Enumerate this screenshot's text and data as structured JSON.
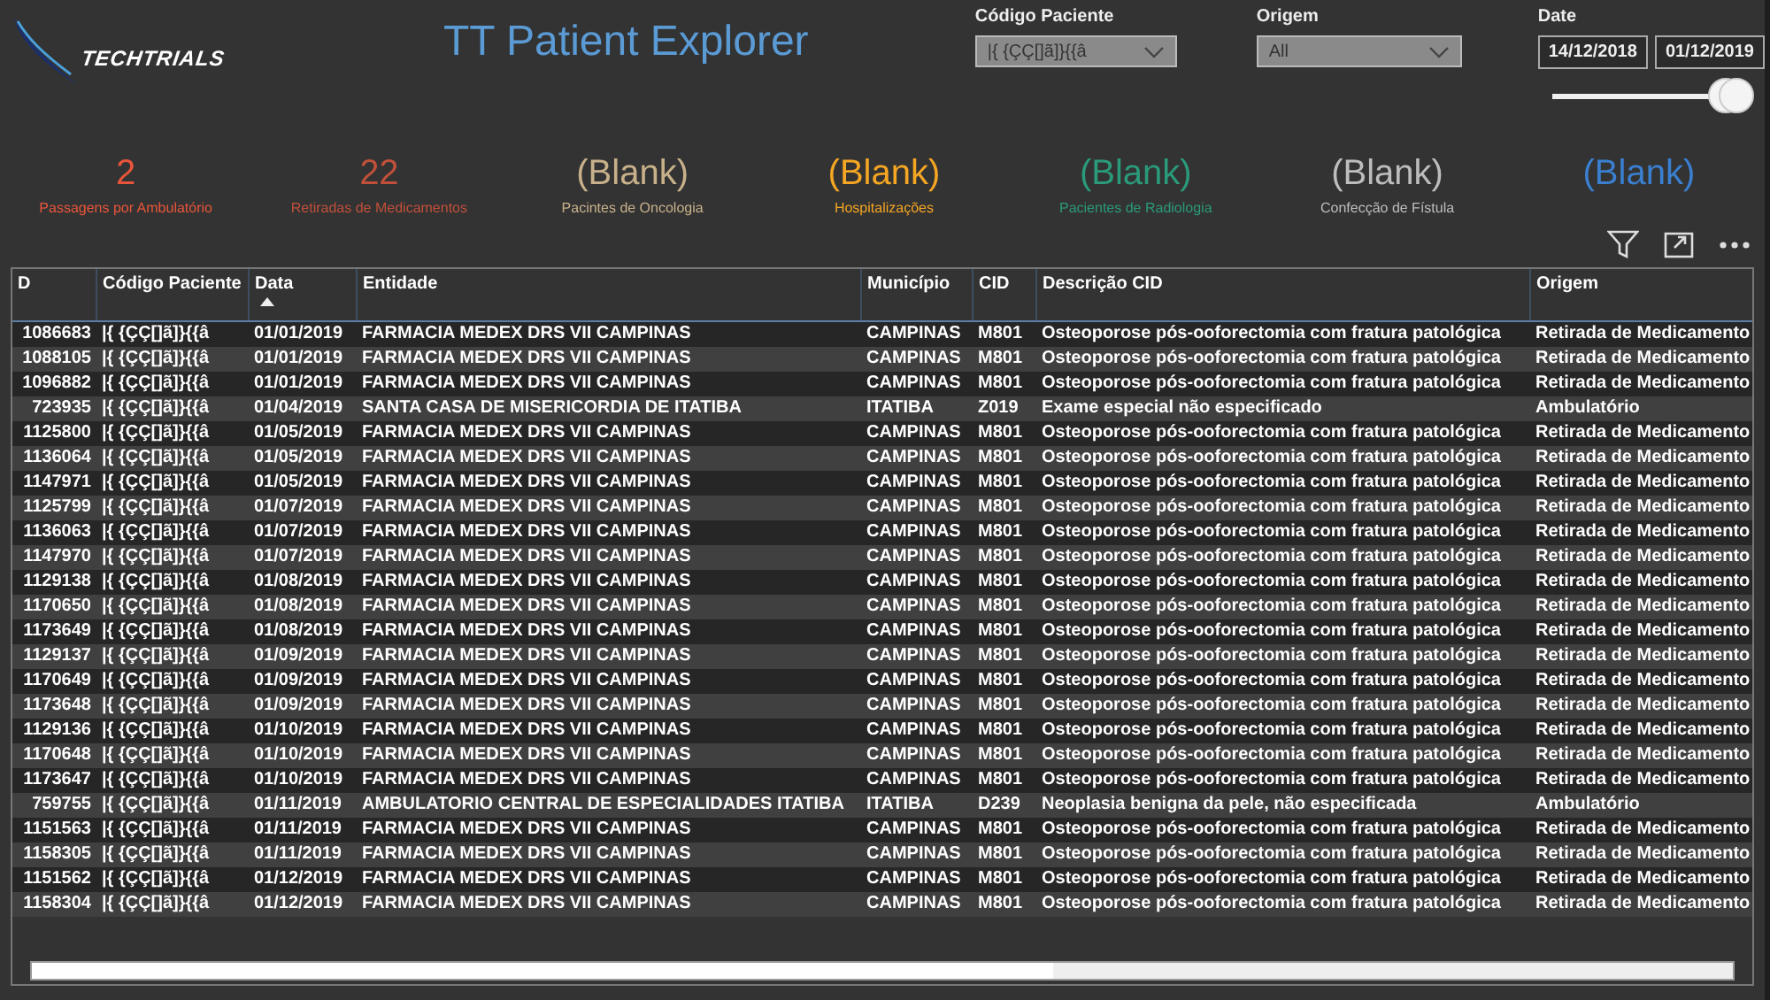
{
  "header": {
    "logo_text": "TECHTRIALS",
    "title": "TT Patient Explorer"
  },
  "filters": [
    {
      "kind": "dropdown",
      "label": "Código Paciente",
      "value": "|{ {ÇÇ[]ã]}{{â"
    },
    {
      "kind": "dropdown",
      "label": "Origem",
      "value": "All"
    },
    {
      "kind": "daterange",
      "label": "Date",
      "from": "14/12/2018",
      "to": "01/12/2019",
      "level": 1
    }
  ],
  "kpis": [
    {
      "value": "2",
      "label": "Passagens por Ambulatório",
      "color": "#e8553a"
    },
    {
      "value": "22",
      "label": "Retiradas de Medicamentos",
      "color": "#c0503a"
    },
    {
      "value": "(Blank)",
      "label": "Pacintes de Oncologia",
      "color": "#c8b18a"
    },
    {
      "value": "(Blank)",
      "label": "Hospitalizações",
      "color": "#f5a623"
    },
    {
      "value": "(Blank)",
      "label": "Pacientes de Radiologia",
      "color": "#2a9a7a"
    },
    {
      "value": "(Blank)",
      "label": "Confecção de Fístula",
      "color": "#bdbdbd"
    },
    {
      "value": "(Blank)",
      "color": "#3a7fd0"
    }
  ],
  "table": {
    "columns": [
      {
        "label": "D",
        "sorted": false
      },
      {
        "label": "Código Paciente",
        "sorted": false
      },
      {
        "label": "Data",
        "sorted": true
      },
      {
        "label": "Entidade",
        "sorted": false
      },
      {
        "label": "Município",
        "sorted": false
      },
      {
        "label": "CID",
        "sorted": false
      },
      {
        "label": "Descrição CID",
        "sorted": false
      },
      {
        "label": "Origem",
        "sorted": false
      }
    ],
    "rows": [
      {
        "cells": [
          "1086683",
          "|{ {ÇÇ[]ã]}{{â",
          "01/01/2019",
          "FARMACIA MEDEX DRS VII CAMPINAS",
          "CAMPINAS",
          "M801",
          "Osteoporose pós-ooforectomia com fratura patológica",
          "Retirada de Medicamento"
        ]
      },
      {
        "cells": [
          "1088105",
          "|{ {ÇÇ[]ã]}{{â",
          "01/01/2019",
          "FARMACIA MEDEX DRS VII CAMPINAS",
          "CAMPINAS",
          "M801",
          "Osteoporose pós-ooforectomia com fratura patológica",
          "Retirada de Medicamento"
        ]
      },
      {
        "cells": [
          "1096882",
          "|{ {ÇÇ[]ã]}{{â",
          "01/01/2019",
          "FARMACIA MEDEX DRS VII CAMPINAS",
          "CAMPINAS",
          "M801",
          "Osteoporose pós-ooforectomia com fratura patológica",
          "Retirada de Medicamento"
        ]
      },
      {
        "cells": [
          "723935",
          "|{ {ÇÇ[]ã]}{{â",
          "01/04/2019",
          "SANTA CASA DE MISERICORDIA DE ITATIBA",
          "ITATIBA",
          "Z019",
          "Exame especial não especificado",
          "Ambulatório"
        ]
      },
      {
        "cells": [
          "1125800",
          "|{ {ÇÇ[]ã]}{{â",
          "01/05/2019",
          "FARMACIA MEDEX DRS VII CAMPINAS",
          "CAMPINAS",
          "M801",
          "Osteoporose pós-ooforectomia com fratura patológica",
          "Retirada de Medicamento"
        ]
      },
      {
        "cells": [
          "1136064",
          "|{ {ÇÇ[]ã]}{{â",
          "01/05/2019",
          "FARMACIA MEDEX DRS VII CAMPINAS",
          "CAMPINAS",
          "M801",
          "Osteoporose pós-ooforectomia com fratura patológica",
          "Retirada de Medicamento"
        ]
      },
      {
        "cells": [
          "1147971",
          "|{ {ÇÇ[]ã]}{{â",
          "01/05/2019",
          "FARMACIA MEDEX DRS VII CAMPINAS",
          "CAMPINAS",
          "M801",
          "Osteoporose pós-ooforectomia com fratura patológica",
          "Retirada de Medicamento"
        ]
      },
      {
        "cells": [
          "1125799",
          "|{ {ÇÇ[]ã]}{{â",
          "01/07/2019",
          "FARMACIA MEDEX DRS VII CAMPINAS",
          "CAMPINAS",
          "M801",
          "Osteoporose pós-ooforectomia com fratura patológica",
          "Retirada de Medicamento"
        ]
      },
      {
        "cells": [
          "1136063",
          "|{ {ÇÇ[]ã]}{{â",
          "01/07/2019",
          "FARMACIA MEDEX DRS VII CAMPINAS",
          "CAMPINAS",
          "M801",
          "Osteoporose pós-ooforectomia com fratura patológica",
          "Retirada de Medicamento"
        ]
      },
      {
        "cells": [
          "1147970",
          "|{ {ÇÇ[]ã]}{{â",
          "01/07/2019",
          "FARMACIA MEDEX DRS VII CAMPINAS",
          "CAMPINAS",
          "M801",
          "Osteoporose pós-ooforectomia com fratura patológica",
          "Retirada de Medicamento"
        ]
      },
      {
        "cells": [
          "1129138",
          "|{ {ÇÇ[]ã]}{{â",
          "01/08/2019",
          "FARMACIA MEDEX DRS VII CAMPINAS",
          "CAMPINAS",
          "M801",
          "Osteoporose pós-ooforectomia com fratura patológica",
          "Retirada de Medicamento"
        ]
      },
      {
        "cells": [
          "1170650",
          "|{ {ÇÇ[]ã]}{{â",
          "01/08/2019",
          "FARMACIA MEDEX DRS VII CAMPINAS",
          "CAMPINAS",
          "M801",
          "Osteoporose pós-ooforectomia com fratura patológica",
          "Retirada de Medicamento"
        ]
      },
      {
        "cells": [
          "1173649",
          "|{ {ÇÇ[]ã]}{{â",
          "01/08/2019",
          "FARMACIA MEDEX DRS VII CAMPINAS",
          "CAMPINAS",
          "M801",
          "Osteoporose pós-ooforectomia com fratura patológica",
          "Retirada de Medicamento"
        ]
      },
      {
        "cells": [
          "1129137",
          "|{ {ÇÇ[]ã]}{{â",
          "01/09/2019",
          "FARMACIA MEDEX DRS VII CAMPINAS",
          "CAMPINAS",
          "M801",
          "Osteoporose pós-ooforectomia com fratura patológica",
          "Retirada de Medicamento"
        ]
      },
      {
        "cells": [
          "1170649",
          "|{ {ÇÇ[]ã]}{{â",
          "01/09/2019",
          "FARMACIA MEDEX DRS VII CAMPINAS",
          "CAMPINAS",
          "M801",
          "Osteoporose pós-ooforectomia com fratura patológica",
          "Retirada de Medicamento"
        ]
      },
      {
        "cells": [
          "1173648",
          "|{ {ÇÇ[]ã]}{{â",
          "01/09/2019",
          "FARMACIA MEDEX DRS VII CAMPINAS",
          "CAMPINAS",
          "M801",
          "Osteoporose pós-ooforectomia com fratura patológica",
          "Retirada de Medicamento"
        ]
      },
      {
        "cells": [
          "1129136",
          "|{ {ÇÇ[]ã]}{{â",
          "01/10/2019",
          "FARMACIA MEDEX DRS VII CAMPINAS",
          "CAMPINAS",
          "M801",
          "Osteoporose pós-ooforectomia com fratura patológica",
          "Retirada de Medicamento"
        ]
      },
      {
        "cells": [
          "1170648",
          "|{ {ÇÇ[]ã]}{{â",
          "01/10/2019",
          "FARMACIA MEDEX DRS VII CAMPINAS",
          "CAMPINAS",
          "M801",
          "Osteoporose pós-ooforectomia com fratura patológica",
          "Retirada de Medicamento"
        ]
      },
      {
        "cells": [
          "1173647",
          "|{ {ÇÇ[]ã]}{{â",
          "01/10/2019",
          "FARMACIA MEDEX DRS VII CAMPINAS",
          "CAMPINAS",
          "M801",
          "Osteoporose pós-ooforectomia com fratura patológica",
          "Retirada de Medicamento"
        ]
      },
      {
        "cells": [
          "759755",
          "|{ {ÇÇ[]ã]}{{â",
          "01/11/2019",
          "AMBULATORIO CENTRAL DE ESPECIALIDADES ITATIBA",
          "ITATIBA",
          "D239",
          "Neoplasia benigna da pele, não especificada",
          "Ambulatório"
        ]
      },
      {
        "cells": [
          "1151563",
          "|{ {ÇÇ[]ã]}{{â",
          "01/11/2019",
          "FARMACIA MEDEX DRS VII CAMPINAS",
          "CAMPINAS",
          "M801",
          "Osteoporose pós-ooforectomia com fratura patológica",
          "Retirada de Medicamento"
        ]
      },
      {
        "cells": [
          "1158305",
          "|{ {ÇÇ[]ã]}{{â",
          "01/11/2019",
          "FARMACIA MEDEX DRS VII CAMPINAS",
          "CAMPINAS",
          "M801",
          "Osteoporose pós-ooforectomia com fratura patológica",
          "Retirada de Medicamento"
        ]
      },
      {
        "cells": [
          "1151562",
          "|{ {ÇÇ[]ã]}{{â",
          "01/12/2019",
          "FARMACIA MEDEX DRS VII CAMPINAS",
          "CAMPINAS",
          "M801",
          "Osteoporose pós-ooforectomia com fratura patológica",
          "Retirada de Medicamento"
        ]
      },
      {
        "cells": [
          "1158304",
          "|{ {ÇÇ[]ã]}{{â",
          "01/12/2019",
          "FARMACIA MEDEX DRS VII CAMPINAS",
          "CAMPINAS",
          "M801",
          "Osteoporose pós-ooforectomia com fratura patológica",
          "Retirada de Medicamento"
        ]
      }
    ]
  }
}
